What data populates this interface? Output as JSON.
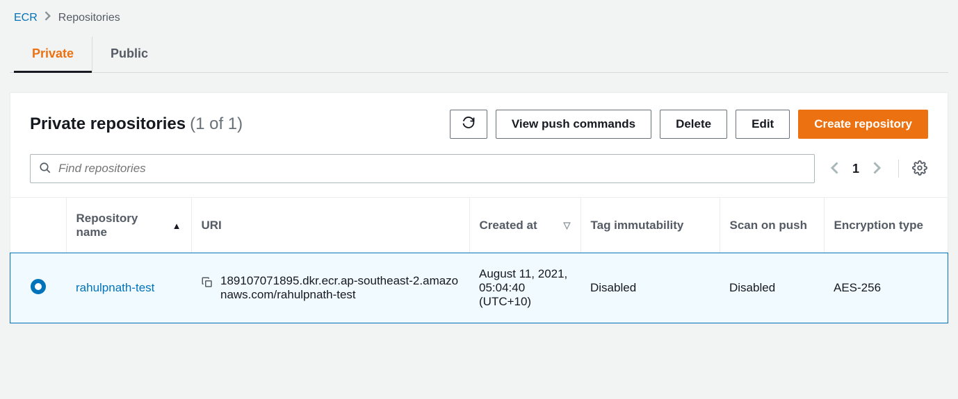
{
  "breadcrumb": {
    "root": "ECR",
    "current": "Repositories"
  },
  "tabs": {
    "private": "Private",
    "public": "Public"
  },
  "panel": {
    "title": "Private repositories",
    "count": "(1 of 1)"
  },
  "buttons": {
    "view_push": "View push commands",
    "delete": "Delete",
    "edit": "Edit",
    "create": "Create repository"
  },
  "search": {
    "placeholder": "Find repositories"
  },
  "pagination": {
    "page": "1"
  },
  "columns": {
    "repo_name": "Repository name",
    "uri": "URI",
    "created": "Created at",
    "tag_immut": "Tag immutability",
    "scan_push": "Scan on push",
    "enc_type": "Encryption type"
  },
  "rows": [
    {
      "name": "rahulpnath-test",
      "uri": "189107071895.dkr.ecr.ap-southeast-2.amazonaws.com/rahulpnath-test",
      "created": "August 11, 2021, 05:04:40 (UTC+10)",
      "tag_immut": "Disabled",
      "scan_push": "Disabled",
      "enc_type": "AES-256"
    }
  ]
}
